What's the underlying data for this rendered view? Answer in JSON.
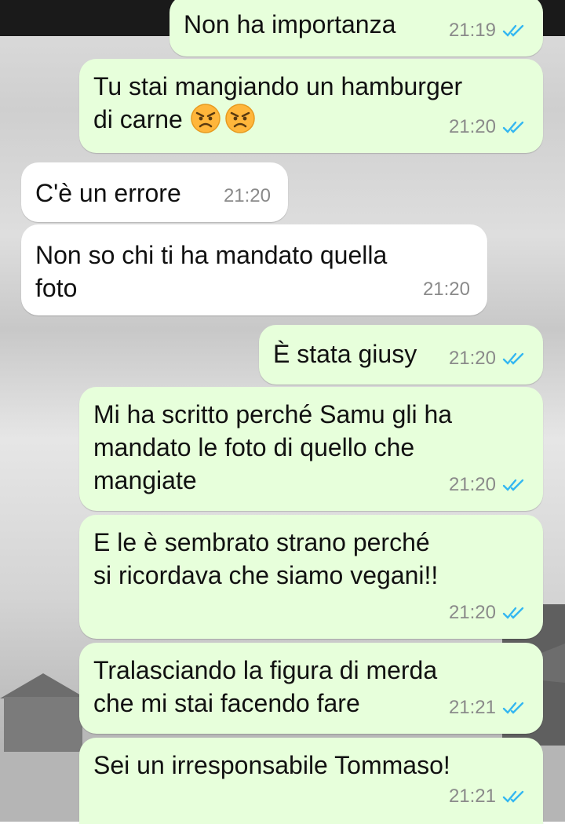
{
  "colors": {
    "outgoing": "#e7ffdb",
    "incoming": "#ffffff",
    "read_ticks": "#34b7f1",
    "time": "#8a8a8a"
  },
  "messages": [
    {
      "dir": "out",
      "text": "Non ha importanza",
      "time": "21:19"
    },
    {
      "dir": "out",
      "text": "Tu stai mangiando un hamburger\ndi carne",
      "emoji": "angry-face-icon x2",
      "time": "21:20"
    },
    {
      "dir": "in",
      "text": "C'è un errore",
      "time": "21:20"
    },
    {
      "dir": "in",
      "text": "Non so chi ti ha mandato quella\nfoto",
      "time": "21:20"
    },
    {
      "dir": "out",
      "text": "È stata giusy",
      "time": "21:20"
    },
    {
      "dir": "out",
      "text": "Mi ha scritto perché Samu gli ha\nmandato le foto di quello che\nmangiate",
      "time": "21:20"
    },
    {
      "dir": "out",
      "text": "E le è sembrato strano perché\nsi ricordava che siamo vegani!!",
      "time": "21:20"
    },
    {
      "dir": "out",
      "text": "Tralasciando la figura di merda\nche mi stai facendo fare",
      "time": "21:21"
    },
    {
      "dir": "out",
      "text": "Sei un irresponsabile Tommaso!",
      "time": "21:21"
    }
  ]
}
